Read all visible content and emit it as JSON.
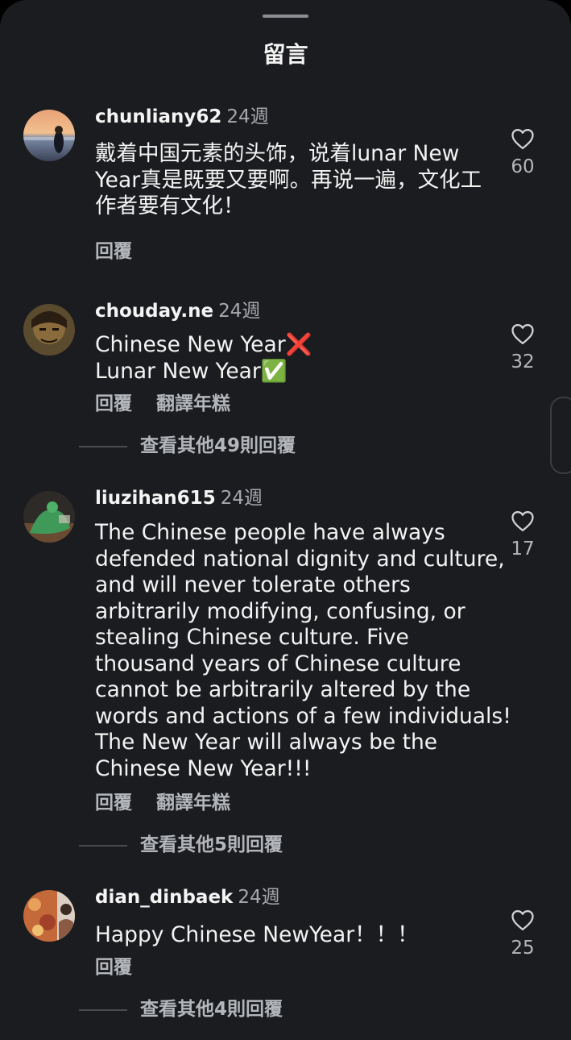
{
  "sheet": {
    "title": "留言"
  },
  "comments": [
    {
      "username": "chunliany62",
      "time": "24週",
      "text": "戴着中国元素的头饰，说着lunar New Year真是既要又要啊。再说一遍，文化工作者要有文化！",
      "reply_label": "回覆",
      "translate_label": "",
      "likes": "60",
      "view_replies": ""
    },
    {
      "username": "chouday.ne",
      "time": "24週",
      "text": "Chinese New Year❌\nLunar New Year✅",
      "reply_label": "回覆",
      "translate_label": "翻譯年糕",
      "likes": "32",
      "view_replies": "查看其他49則回覆"
    },
    {
      "username": "liuzihan615",
      "time": "24週",
      "text": "The Chinese people have always defended national dignity and culture, and will never tolerate others arbitrarily modifying, confusing, or stealing Chinese culture. Five thousand years of Chinese culture cannot be arbitrarily altered by the words and actions of a few individuals! The New Year will always be the Chinese New Year!!!",
      "reply_label": "回覆",
      "translate_label": "翻譯年糕",
      "likes": "17",
      "view_replies": "查看其他5則回覆"
    },
    {
      "username": "dian_dinbaek",
      "time": "24週",
      "text": "Happy Chinese NewYear！！！",
      "reply_label": "回覆",
      "translate_label": "",
      "likes": "25",
      "view_replies": "查看其他4則回覆"
    }
  ],
  "icons": {
    "like": "heart-outline-icon"
  },
  "colors": {
    "background": "#1b1c1f",
    "text": "#f3f3f3",
    "secondary": "#a5a8ad"
  }
}
